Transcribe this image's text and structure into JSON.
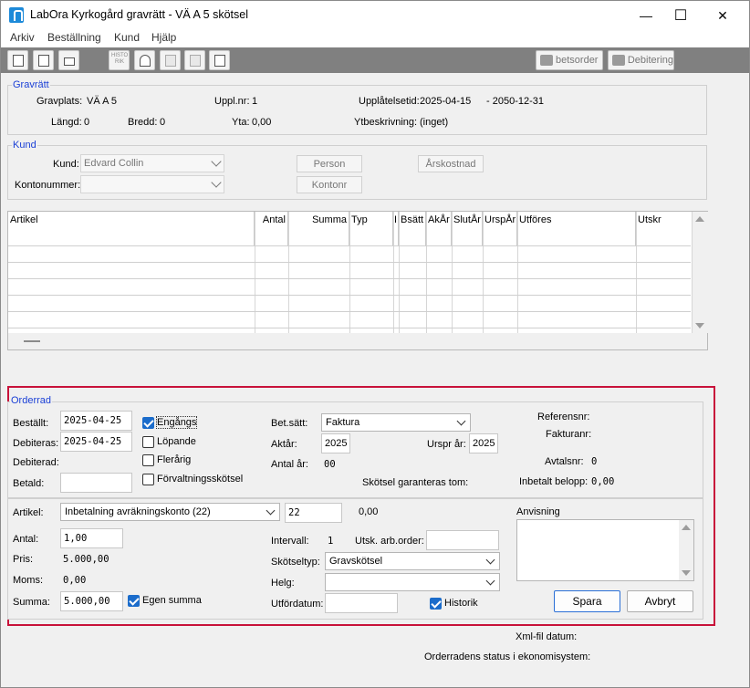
{
  "window": {
    "title": "LabOra Kyrkogård gravrätt - VÄ A  5 skötsel",
    "minimize_glyph": "—",
    "maximize_glyph": "☐",
    "close_glyph": "✕"
  },
  "menu": [
    "Arkiv",
    "Beställning",
    "Kund",
    "Hjälp"
  ],
  "toolbar": {
    "icons": [
      "folder-icon",
      "document-icon",
      "print-icon",
      "historik-icon",
      "people-icon",
      "move-icon",
      "map-icon",
      "image-icon"
    ],
    "historik_text": "HISTO RIK",
    "betsorder_label": "betsorder",
    "debitering_label": "Debitering"
  },
  "gravratt": {
    "section_label": "Gravrätt",
    "gravplats_label": "Gravplats:",
    "gravplats_value": "VÄ A  5",
    "upplnr_label": "Uppl.nr:",
    "upplnr_value": "1",
    "upplatelsetid_label": "Upplåtelsetid:",
    "upplatelsetid_from": "2025-04-15",
    "upplatelsetid_to": "- 2050-12-31",
    "langd_label": "Längd:",
    "langd_value": "0",
    "bredd_label": "Bredd:",
    "bredd_value": "0",
    "yta_label": "Yta:",
    "yta_value": "0,00",
    "ytbeskrivning_label": "Ytbeskrivning:",
    "ytbeskrivning_value": "(inget)"
  },
  "kund": {
    "section_label": "Kund",
    "kund_label": "Kund:",
    "kund_value": "Edvard  Collin",
    "kontonummer_label": "Kontonummer:",
    "kontonummer_value": "",
    "person_button": "Person",
    "kontonr_button": "Kontonr",
    "arskostnad_button": "Årskostnad"
  },
  "grid": {
    "columns": [
      "Artikel",
      "Antal",
      "Summa",
      "Typ",
      "I",
      "Bsätt",
      "AkÅr",
      "SlutÅr",
      "UrspÅr",
      "Utföres",
      "Utskr"
    ],
    "rows": []
  },
  "orderrad": {
    "section_label": "Orderrad",
    "bestallt_label": "Beställt:",
    "bestallt_value": "2025-04-25",
    "debiteras_label": "Debiteras:",
    "debiteras_value": "2025-04-25",
    "debiterad_label": "Debiterad:",
    "betald_label": "Betald:",
    "betald_value": "",
    "engangs_label": "Engångs",
    "lopande_label": "Löpande",
    "flerarig_label": "Flerårig",
    "forvaltning_label": "Förvaltningsskötsel",
    "betsatt_label": "Bet.sätt:",
    "betsatt_value": "Faktura",
    "aktar_label": "Aktår:",
    "aktar_value": "2025",
    "ursprar_label": "Urspr år:",
    "ursprar_value": "2025",
    "antalar_label": "Antal år:",
    "antalar_value": "00",
    "skotsel_garanteras_label": "Skötsel garanteras tom:",
    "referensnr_label": "Referensnr:",
    "fakturanr_label": "Fakturanr:",
    "avtalsnr_label": "Avtalsnr:",
    "avtalsnr_value": "0",
    "inbetalt_label": "Inbetalt belopp:",
    "inbetalt_value": "0,00",
    "artikel_label": "Artikel:",
    "artikel_value": "Inbetalning avräkningskonto (22)",
    "artikel_code": "22",
    "artikel_amount": "0,00",
    "antal_label": "Antal:",
    "antal_value": "1,00",
    "pris_label": "Pris:",
    "pris_value": "5.000,00",
    "moms_label": "Moms:",
    "moms_value": "0,00",
    "summa_label": "Summa:",
    "summa_value": "5.000,00",
    "egen_summa_label": "Egen summa",
    "intervall_label": "Intervall:",
    "intervall_value": "1",
    "utsk_label": "Utsk. arb.order:",
    "utsk_value": "",
    "skotseltyp_label": "Skötseltyp:",
    "skotseltyp_value": "Gravskötsel",
    "helg_label": "Helg:",
    "helg_value": "",
    "utfordatum_label": "Utfördatum:",
    "utfordatum_value": "",
    "historik_label": "Historik",
    "anvisning_label": "Anvisning",
    "anvisning_value": "",
    "spara_button": "Spara",
    "avbryt_button": "Avbryt"
  },
  "footer": {
    "xml_label": "Xml-fil datum:",
    "status_label": "Orderradens status i ekonomisystem:"
  },
  "colors": {
    "accent_blue": "#1a3fd6",
    "highlight_red": "#c8123a",
    "toolbar_gray": "#808080",
    "checkbox_blue": "#1b6ccb"
  }
}
